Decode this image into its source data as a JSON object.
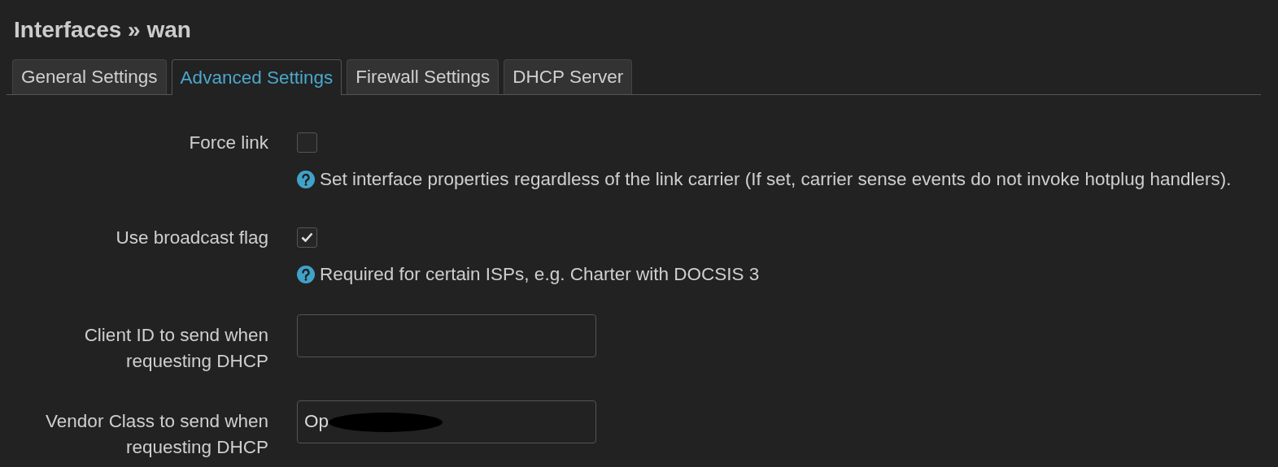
{
  "title": "Interfaces » wan",
  "tabs": [
    {
      "label": "General Settings",
      "selected": false
    },
    {
      "label": "Advanced Settings",
      "selected": true
    },
    {
      "label": "Firewall Settings",
      "selected": false
    },
    {
      "label": "DHCP Server",
      "selected": false
    }
  ],
  "fields": [
    {
      "kind": "checkbox",
      "label": "Force link",
      "checked": false,
      "help": "Set interface properties regardless of the link carrier (If set, carrier sense events do not invoke hotplug handlers)."
    },
    {
      "kind": "checkbox",
      "label": "Use broadcast flag",
      "checked": true,
      "help": "Required for certain ISPs, e.g. Charter with DOCSIS 3"
    },
    {
      "kind": "text",
      "label": "Client ID to send when requesting DHCP"
    },
    {
      "kind": "text",
      "label": "Vendor Class to send when requesting DHCP",
      "value": "Op",
      "redacted": true
    }
  ]
}
